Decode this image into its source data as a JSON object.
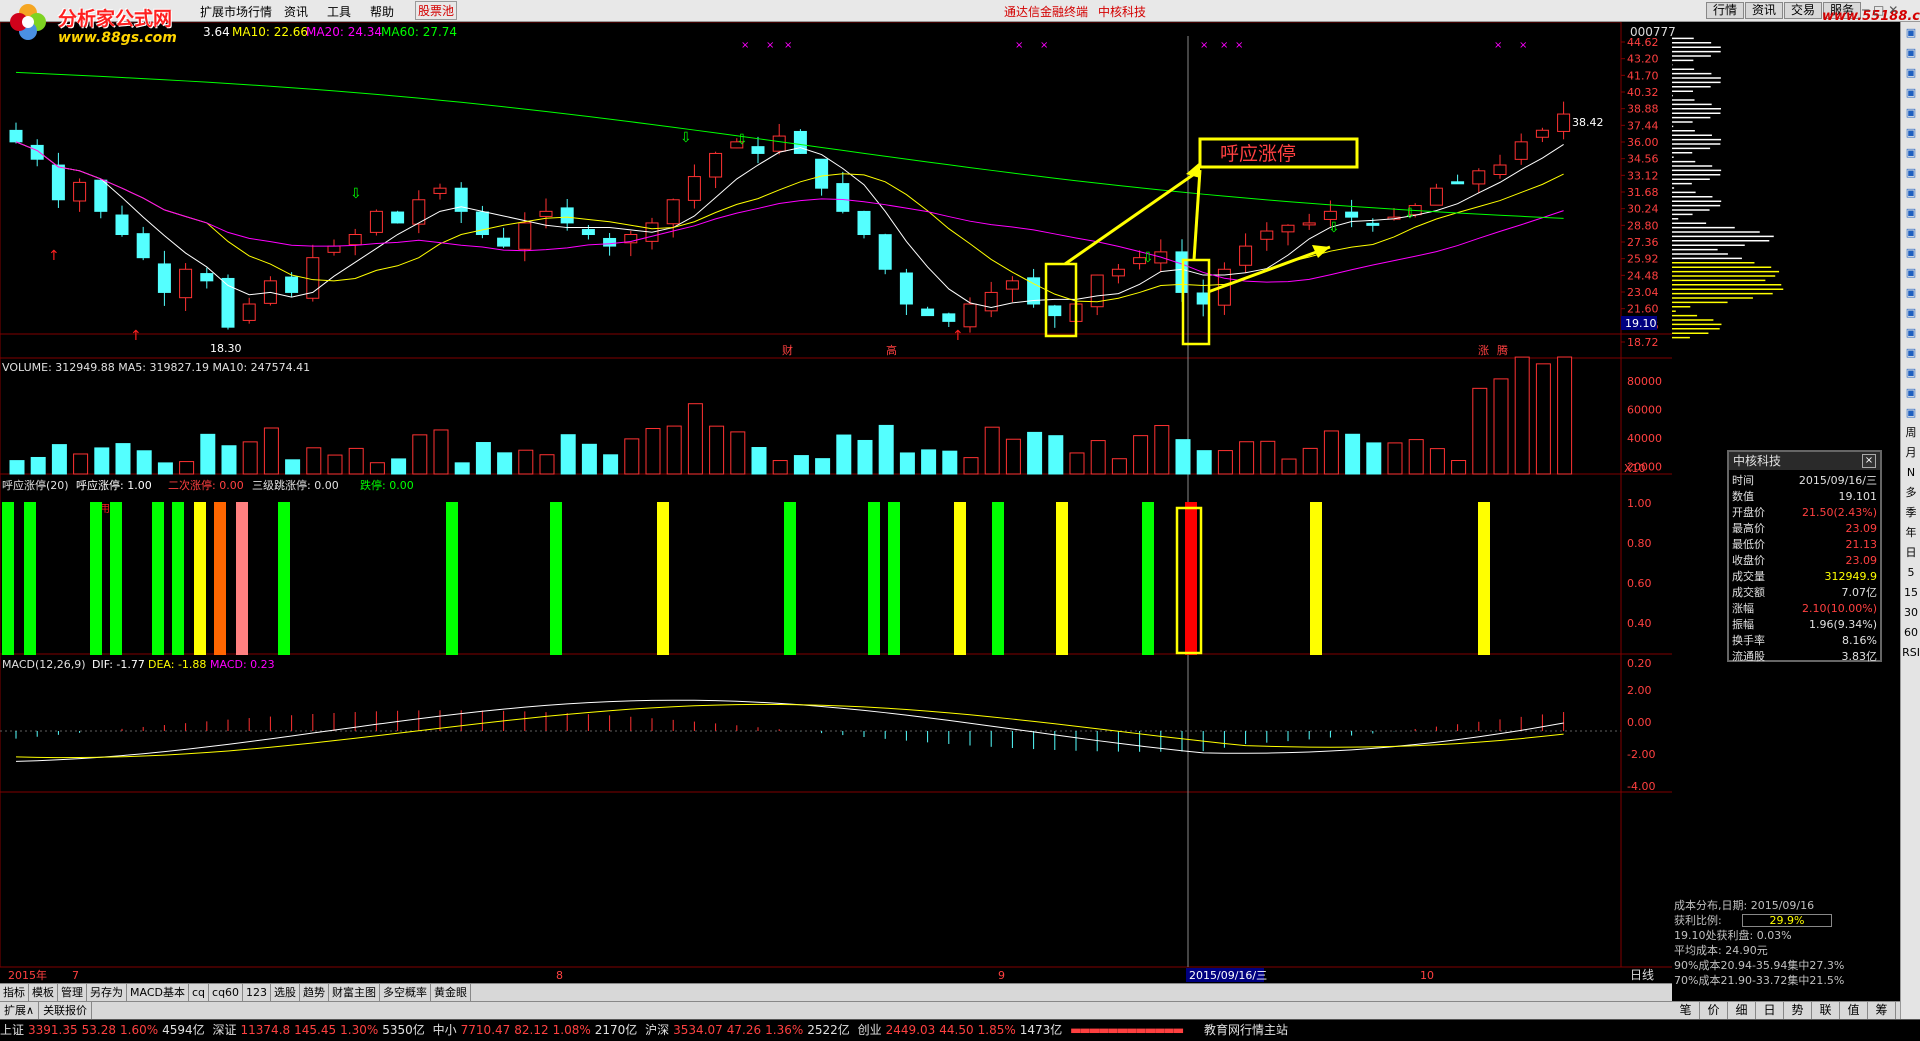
{
  "app": {
    "title": "通达信金融终端",
    "stock_header": "中核科技",
    "watermark_title": "分析家公式网",
    "watermark_url": "www.88gs.com",
    "right_watermark": "www.55188.com",
    "stock_code": "000777"
  },
  "menu": [
    "扩展市场行情",
    "资讯",
    "工具",
    "帮助",
    "股票池"
  ],
  "top_tabs": [
    "行情",
    "资讯",
    "交易",
    "服务"
  ],
  "ma_header": {
    "ma5": "3.64",
    "ma10": "MA10: 22.66",
    "ma20": "MA20: 24.34",
    "ma60": "MA60: 27.74"
  },
  "price_axis": [
    "44.62",
    "43.20",
    "41.70",
    "40.32",
    "38.88",
    "37.44",
    "36.00",
    "34.56",
    "33.12",
    "31.68",
    "30.24",
    "28.80",
    "27.36",
    "25.92",
    "24.48",
    "23.04",
    "21.60",
    "20.16",
    "18.72"
  ],
  "current_price_label": "19.10",
  "high_label": "38.42",
  "low_label": "18.30",
  "event_labels": {
    "cai": "财",
    "gao": "高",
    "zhang": "涨",
    "teng": "腾"
  },
  "annotation": "呼应涨停",
  "volume": {
    "header": "VOLUME: 312949.88  MA5: 319827.19  MA10: 247574.41",
    "axis": [
      "80000",
      "60000",
      "40000",
      "20000"
    ],
    "unit": "X10"
  },
  "indicator": {
    "header_name": "呼应涨停(20)",
    "header_v1": "呼应涨停: 1.00",
    "header_v2": "二次涨停: 0.00",
    "header_v3": "三级跳涨停: 0.00",
    "header_v4": "跌停: 0.00",
    "axis": [
      "1.00",
      "0.80",
      "0.60",
      "0.40",
      "0.20"
    ],
    "trial_text": "试用期"
  },
  "macd": {
    "header_name": "MACD(12,26,9)",
    "dif": "DIF: -1.77",
    "dea": "DEA: -1.88",
    "macd": "MACD: 0.23",
    "axis": [
      "2.00",
      "0.00",
      "-2.00",
      "-4.00"
    ]
  },
  "date_axis": {
    "year": "2015年",
    "m7": "7",
    "m8": "8",
    "m9": "9",
    "m10": "10",
    "cursor_date": "2015/09/16/三",
    "period": "日线"
  },
  "infobox": {
    "title": "中核科技",
    "rows": [
      {
        "k": "时间",
        "v": "2015/09/16/三",
        "c": "#e0e0e0"
      },
      {
        "k": "数值",
        "v": "19.101",
        "c": "#e0e0e0"
      },
      {
        "k": "开盘价",
        "v": "21.50(2.43%)",
        "c": "#ff4040"
      },
      {
        "k": "最高价",
        "v": "23.09",
        "c": "#ff4040"
      },
      {
        "k": "最低价",
        "v": "21.13",
        "c": "#ff4040"
      },
      {
        "k": "收盘价",
        "v": "23.09",
        "c": "#ff4040"
      },
      {
        "k": "成交量",
        "v": "312949.9",
        "c": "#ffff00"
      },
      {
        "k": "成交额",
        "v": "7.07亿",
        "c": "#e0e0e0"
      },
      {
        "k": "涨幅",
        "v": "2.10(10.00%)",
        "c": "#ff4040"
      },
      {
        "k": "振幅",
        "v": "1.96(9.34%)",
        "c": "#e0e0e0"
      },
      {
        "k": "换手率",
        "v": "8.16%",
        "c": "#e0e0e0"
      },
      {
        "k": "流通股",
        "v": "3.83亿",
        "c": "#e0e0e0"
      }
    ]
  },
  "cost": {
    "date_line": "成本分布,日期: 2015/09/16",
    "profit_label": "获利比例:",
    "profit_value": "29.9%",
    "line3": "19.10处获利盘: 0.03%",
    "line4": "平均成本: 24.90元",
    "line5": "90%成本20.94-35.94集中27.3%",
    "line6": "70%成本21.90-33.72集中21.5%"
  },
  "bottom_tabs": [
    "指标",
    "模板",
    "管理",
    "另存为",
    "MACD基本",
    "cq",
    "cq60",
    "123",
    "选股",
    "趋势",
    "财富主图",
    "多空概率",
    "黄金眼"
  ],
  "bottom_tabs2": [
    "扩展∧",
    "关联报价"
  ],
  "right_tabs": [
    "笔",
    "价",
    "细",
    "日",
    "势",
    "联",
    "值",
    "筹"
  ],
  "sidebar_icons": [
    "周",
    "月",
    "N",
    "多",
    "季",
    "年",
    "日",
    "5",
    "15",
    "30",
    "60",
    "RSI"
  ],
  "status": {
    "sh_label": "上证",
    "sh_val": "3391.35",
    "sh_chg": "53.28",
    "sh_pct": "1.60%",
    "sh_amt": "4594亿",
    "sz_label": "深证",
    "sz_val": "11374.8",
    "sz_chg": "145.45",
    "sz_pct": "1.30%",
    "sz_amt": "5350亿",
    "zx_label": "中小",
    "zx_val": "7710.47",
    "zx_chg": "82.12",
    "zx_pct": "1.08%",
    "zx_amt": "2170亿",
    "hs_label": "沪深",
    "hs_val": "3534.07",
    "hs_chg": "47.26",
    "hs_pct": "1.36%",
    "hs_amt": "2522亿",
    "cy_label": "创业",
    "cy_val": "2449.03",
    "cy_chg": "44.50",
    "cy_pct": "1.85%",
    "cy_amt": "1473亿",
    "site": "教育网行情主站"
  },
  "colors": {
    "up": "#ff3232",
    "down": "#54ffff",
    "ma5": "#ffffff",
    "ma10": "#ffff00",
    "ma20": "#ff00ff",
    "ma60": "#00ff00",
    "green_bar": "#00ff00",
    "yellow_bar": "#ffff00",
    "orange_bar": "#ff6600",
    "pink_bar": "#ff8080",
    "red_bar": "#ff0000"
  }
}
